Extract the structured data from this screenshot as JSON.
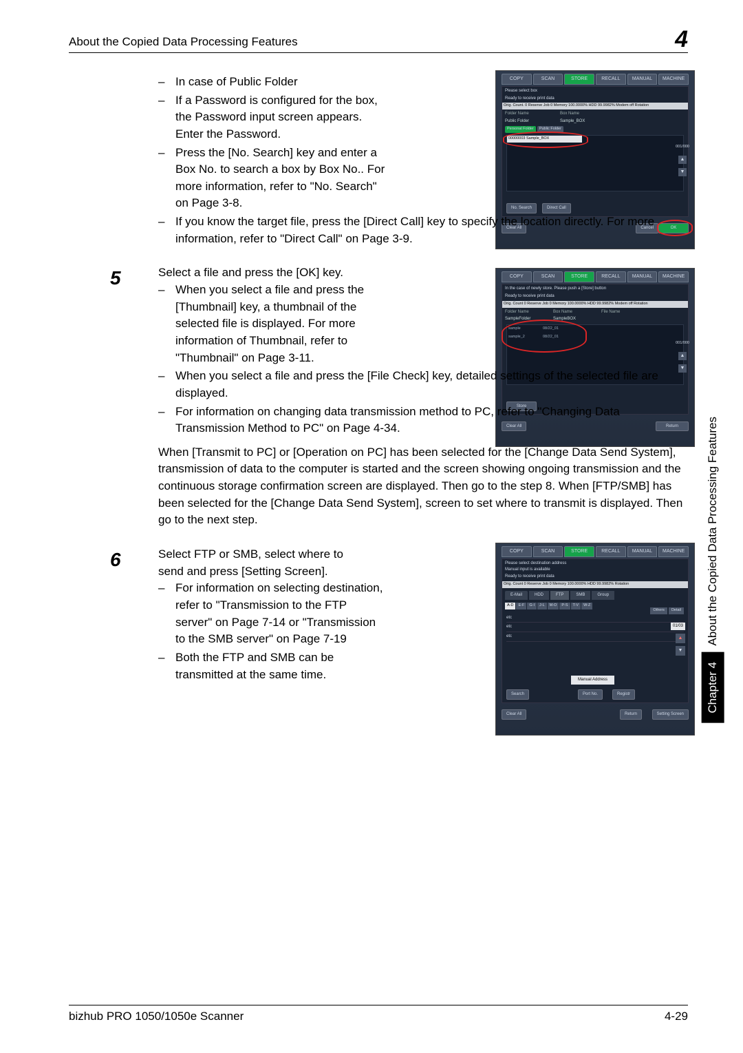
{
  "header": {
    "title": "About the Copied Data Processing Features",
    "chapter_number": "4"
  },
  "sidebar": {
    "chapter_label": "Chapter 4",
    "section_label": "About the Copied Data Processing Features"
  },
  "footer": {
    "product": "bizhub PRO 1050/1050e Scanner",
    "page": "4-29"
  },
  "steps": {
    "pre_items": [
      "In case of Public Folder",
      "If a Password is configured for the box, the Password input screen appears. Enter the Password.",
      "Press the [No. Search] key and enter a Box No. to search a box by Box No.. For more information, refer to \"No. Search\" on Page 3-8.",
      "If you know the target file, press the [Direct Call] key to specify the location directly. For more information, refer to \"Direct Call\" on Page 3-9."
    ],
    "step5": {
      "num": "5",
      "lead": "Select a file and press the [OK] key.",
      "items": [
        "When you select a file and press the [Thumbnail] key, a thumbnail of the selected file is displayed. For more information of Thumbnail, refer to \"Thumbnail\" on Page 3-11.",
        "When you select a file and press the [File Check] key, detailed settings of the selected file are displayed.",
        "For information on changing data transmission method to PC, refer to \"Changing Data Transmission Method to PC\" on Page 4-34."
      ],
      "tail": "When [Transmit to PC] or [Operation on PC] has been selected for the [Change Data Send System], transmission of data to the computer is started and the screen showing ongoing transmission and the continuous storage confirmation screen are displayed. Then go to the step 8. When [FTP/SMB] has been selected for the [Change Data Send System], screen to set where to transmit is displayed. Then go to the next step."
    },
    "step6": {
      "num": "6",
      "lead": "Select FTP or SMB, select where to send and press [Setting Screen].",
      "items": [
        "For information on selecting destination, refer to \"Transmission to the FTP server\" on Page 7-14 or \"Transmission to the SMB server\" on Page 7-19",
        "Both the FTP and SMB can be transmitted at the same time."
      ]
    }
  },
  "screenshots": {
    "s1": {
      "tabs": [
        "COPY",
        "SCAN",
        "STORE",
        "RECALL",
        "MANUAL",
        "MACHINE"
      ],
      "msg": "Please select box",
      "status": "Ready to receive print data",
      "strip": "Orig. Count. 0 Reserve Job 0 Memory 100.0000% HDD 99.9982% Modem off Rotation",
      "cols": [
        "Folder Name",
        "Box Name"
      ],
      "row1a": "Public Folder",
      "row1b": "Sample_BOX",
      "tabs2a": "Personal Folder",
      "tabs2b": "Public Folder",
      "listrow": "00000003   Sample_BOX",
      "count": "001/000",
      "btn1": "No. Search",
      "btn2": "Direct Call",
      "btn3": "Clear All",
      "btn4": "Cancel",
      "btn5": "OK"
    },
    "s2": {
      "msg": "In the case of newly store. Please push a [Store] button",
      "status": "Ready to receive print data",
      "strip": "Orig. Count 0 Reserve Job 0 Memory 100.0000% HDD 99.9982% Modem off Rotation",
      "cols": [
        "Folder Name",
        "Box Name",
        "File Name"
      ],
      "folder": "SampleFolder_",
      "box": "SampleBOX",
      "f1a": "sample",
      "f1b": "08/22_01",
      "f2a": "sample_2",
      "f2b": "08/22_01",
      "count": "001/000",
      "btn_store": "Store",
      "btn_clear": "Clear All",
      "btn_return": "Return"
    },
    "s3": {
      "msg": "Please select destination address\nManual input is available",
      "status": "Ready to receive print data",
      "strip": "Orig. Count 0 Reserve Job 0 Memory 100.0000% HDD 99.9982% Rotation",
      "tab_email": "E-Mail",
      "tab_hdd": "HDD",
      "tab_ftp": "FTP",
      "tab_smb": "SMB",
      "tab_group": "Group",
      "letters": [
        "A-D",
        "E-F",
        "G-I",
        "J-L",
        "M-O",
        "P-S",
        "T-V",
        "W-Z"
      ],
      "others": "Others",
      "detail": "Detail",
      "r1": "etc",
      "r2": "etc",
      "r3": "etc",
      "page": "01/03",
      "manual": "Manual  Address",
      "btn_search": "Search",
      "btn_port": "Port No.",
      "btn_reg": "Registr",
      "btn_clear": "Clear All",
      "btn_return": "Return",
      "btn_set": "Setting Screen"
    }
  }
}
